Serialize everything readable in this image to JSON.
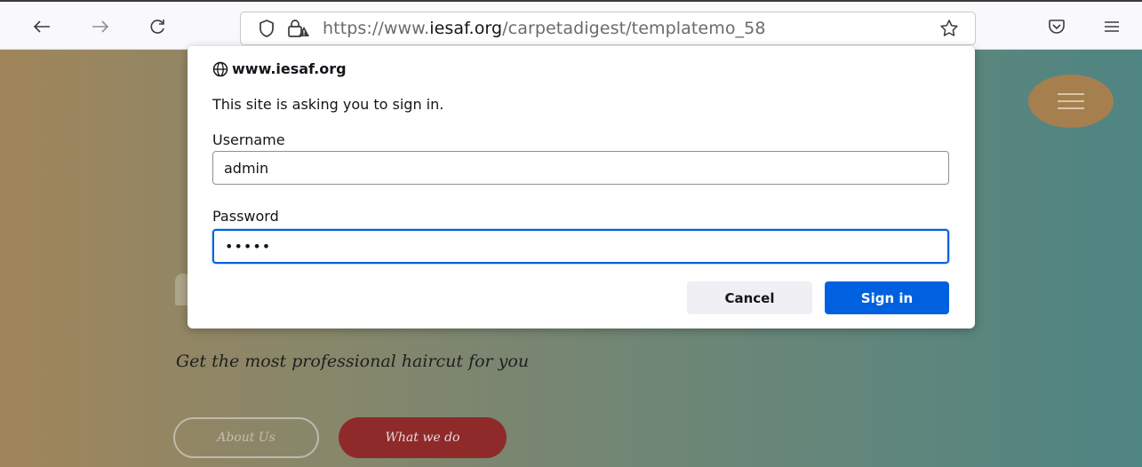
{
  "toolbar": {
    "back_icon": "arrow-left-icon",
    "forward_icon": "arrow-right-icon",
    "reload_icon": "reload-icon",
    "url_prefix": "https://www.",
    "url_host": "iesaf.org",
    "url_path": "/carpetadigest/templatemo_58",
    "bookmark_icon": "star-icon",
    "pocket_icon": "pocket-icon",
    "menu_icon": "hamburger-menu-icon"
  },
  "page": {
    "tagline": "Get the most professional haircut for you",
    "about_button": "About Us",
    "whatwedo_button": "What we do",
    "menu_icon": "hamburger-icon",
    "colors": {
      "gradient_left": "#a0855b",
      "gradient_right": "#4f8582",
      "menu_bg": "#a67f4f",
      "whatwedo_bg": "#8f2a2a"
    }
  },
  "dialog": {
    "site": "www.iesaf.org",
    "message": "This site is asking you to sign in.",
    "username_label": "Username",
    "username_value": "admin",
    "password_label": "Password",
    "password_value": "•••••",
    "cancel_label": "Cancel",
    "signin_label": "Sign in",
    "colors": {
      "accent": "#0061e0",
      "cancel_bg": "#f0f0f4"
    }
  }
}
